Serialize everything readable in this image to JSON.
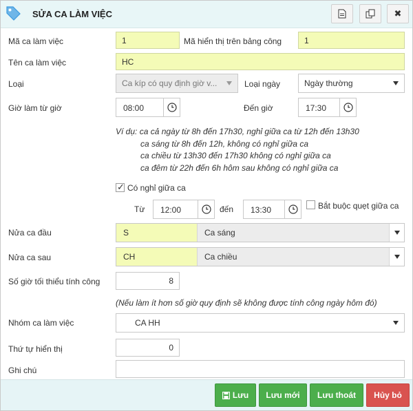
{
  "dialog": {
    "title": "SỬA CA LÀM VIỆC",
    "icons": [
      "tag-icon",
      "document-icon",
      "copy-icon",
      "close-icon"
    ]
  },
  "form": {
    "shift_code": {
      "label": "Mã ca làm việc",
      "value": "1"
    },
    "display_code": {
      "label": "Mã hiển thị trên bảng công",
      "value": "1"
    },
    "shift_name": {
      "label": "Tên ca làm việc",
      "value": "HC"
    },
    "type": {
      "label": "Loại",
      "value": "Ca kíp có quy định giờ v..."
    },
    "day_type": {
      "label": "Loại ngày",
      "value": "Ngày thường"
    },
    "work_from": {
      "label": "Giờ làm từ giờ",
      "value": "08:00"
    },
    "work_to": {
      "label": "Đến giờ",
      "value": "17:30"
    },
    "example_lines": [
      "Ví dụ: ca cả ngày từ 8h đến 17h30, nghỉ giữa ca từ 12h đến 13h30",
      "ca sáng từ 8h đến 12h, không có nghỉ giữa ca",
      "ca chiều từ 13h30 đến 17h30 không có nghỉ giữa ca",
      "ca đêm từ 22h đến 6h hôm sau không có nghỉ giữa ca"
    ],
    "has_break": {
      "label": "Có nghỉ giữa ca",
      "checked": true
    },
    "break_from": {
      "label": "Từ",
      "value": "12:00"
    },
    "break_to": {
      "label": "đến",
      "value": "13:30"
    },
    "force_break_scan": {
      "label": "Bắt buộc quẹt giữa ca",
      "checked": false
    },
    "first_half": {
      "label": "Nửa ca đầu",
      "code": "S",
      "name": "Ca sáng"
    },
    "second_half": {
      "label": "Nửa ca sau",
      "code": "CH",
      "name": "Ca chiều"
    },
    "min_hours": {
      "label": "Số giờ tối thiểu tính công",
      "value": "8"
    },
    "min_hours_note": "(Nếu làm ít hơn số giờ quy định sẽ không được tính công ngày hôm đó)",
    "shift_group": {
      "label": "Nhóm ca làm việc",
      "value": "CA HH"
    },
    "display_order": {
      "label": "Thứ tự hiển thị",
      "value": "0"
    },
    "note": {
      "label": "Ghi chú",
      "value": ""
    }
  },
  "footer": {
    "save": "Lưu",
    "save_new": "Lưu mới",
    "save_exit": "Lưu thoát",
    "cancel": "Hủy bỏ"
  },
  "colors": {
    "title_bg": "#e8f6f7",
    "required_bg": "#f4fbb7",
    "green": "#4cae4c",
    "red": "#d9534f",
    "accent": "#3d9be0"
  }
}
